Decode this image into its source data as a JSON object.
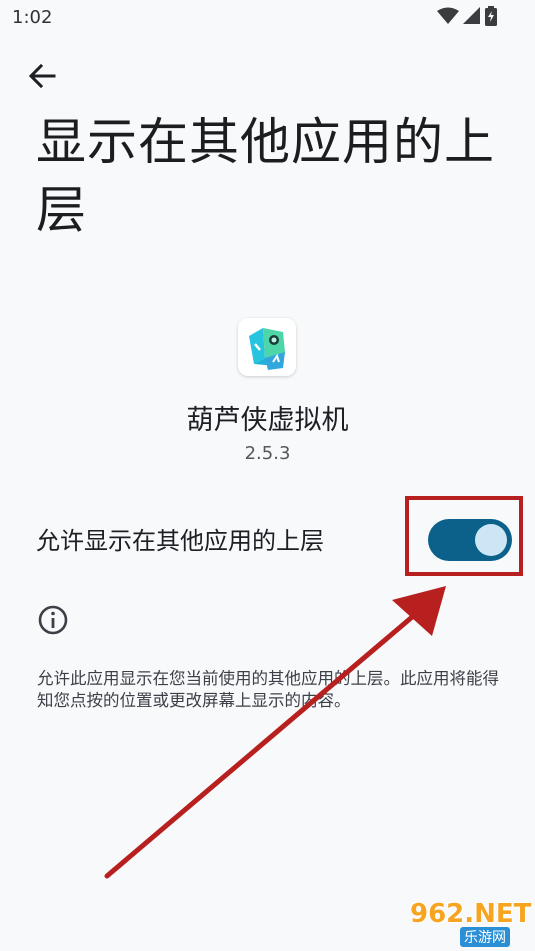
{
  "status_bar": {
    "time": "1:02",
    "icons": [
      "wifi-icon",
      "signal-icon",
      "battery-charging-icon"
    ]
  },
  "header": {
    "back_icon": "arrow-back-icon",
    "title": "显示在其他应用的上层"
  },
  "app": {
    "name": "葫芦侠虚拟机",
    "version": "2.5.3"
  },
  "permission": {
    "label": "允许显示在其他应用的上层",
    "enabled": true
  },
  "info": {
    "icon": "info-icon",
    "description": "允许此应用显示在您当前使用的其他应用的上层。此应用将能得知您点按的位置或更改屏幕上显示的内容。"
  },
  "watermark": {
    "brand": "962.NET",
    "subtitle": "乐游网"
  },
  "colors": {
    "toggle_track": "#0b6189",
    "toggle_thumb": "#cde6f5",
    "annotation": "#b8201f",
    "background": "#f7f9fb"
  }
}
